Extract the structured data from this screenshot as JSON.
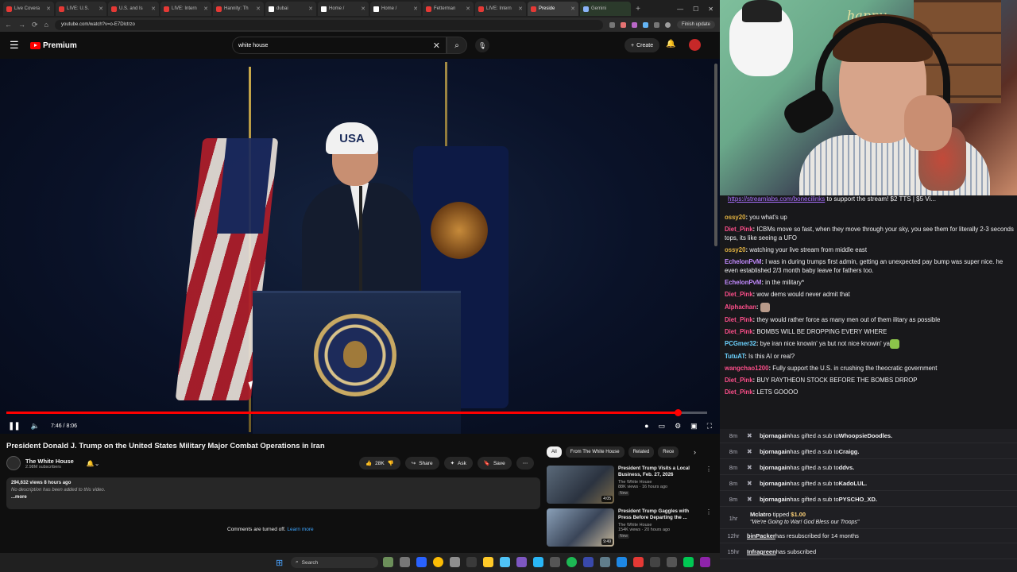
{
  "browser": {
    "tabs": [
      {
        "label": "Live Covera",
        "icon": "red"
      },
      {
        "label": "LIVE: U.S.",
        "icon": "red"
      },
      {
        "label": "U.S. and Is",
        "icon": "red"
      },
      {
        "label": "LIVE: Intern",
        "icon": "red"
      },
      {
        "label": "Hannity: Th",
        "icon": "red"
      },
      {
        "label": "dubai",
        "icon": "x"
      },
      {
        "label": "Home /",
        "icon": "x"
      },
      {
        "label": "Home /",
        "icon": "x"
      },
      {
        "label": "Fetterman",
        "icon": "red"
      },
      {
        "label": "LIVE: Intern",
        "icon": "red"
      },
      {
        "label": "Preside",
        "icon": "red"
      },
      {
        "label": "Gemini",
        "icon": "gem"
      }
    ],
    "url": "youtube.com/watch?v=o-E7Dlctrzo",
    "finish_update": "Finish update"
  },
  "youtube": {
    "brand": "Premium",
    "search_value": "white house",
    "create_label": "Create",
    "video": {
      "time": "7:46 / 8:06",
      "progress_fraction": 0.958,
      "cap_text": "USA"
    },
    "title": "President Donald J. Trump on the United States Military Major Combat Operations in Iran",
    "channel_name": "The White House",
    "subscribers": "2.98M subscribers",
    "actions": {
      "likes": "28K",
      "share": "Share",
      "ask": "Ask",
      "save": "Save"
    },
    "description": {
      "views": "294,632 views  8 hours ago",
      "text": "No description has been added to this video.",
      "more": "...more"
    },
    "comments_text": "Comments are turned off.",
    "comments_link": "Learn more",
    "chips": [
      "All",
      "From The White House",
      "Related",
      "Rece"
    ],
    "recommendations": [
      {
        "title": "President Trump Visits a Local Business, Feb. 27, 2026",
        "channel": "The White House",
        "meta": "88K views · 16 hours ago",
        "badge": "New",
        "duration": "4:05"
      },
      {
        "title": "President Trump Gaggles with Press Before Departing the ...",
        "channel": "The White House",
        "meta": "154K views · 20 hours ago",
        "badge": "New",
        "duration": "9:49"
      }
    ]
  },
  "taskbar": {
    "search_label": "Search"
  },
  "webcam": {
    "sign_text": "happy"
  },
  "chat": {
    "top_link": "https://streamlabs.com/bonecilinks",
    "top_text": " to support the stream! $2 TTS | $5 Vi...",
    "messages": [
      {
        "user": "ossy20",
        "color": "#e3b341",
        "text": " you what's up"
      },
      {
        "user": "Diet_Pink",
        "color": "#ff4f8b",
        "text": " ICBMs move so fast, when they move through your sky, you see them for literally 2-3 seconds tops, its like seeing a UFO"
      },
      {
        "user": "ossy20",
        "color": "#e3b341",
        "text": " watching your live stream from middle east"
      },
      {
        "user": "EchelonPvM",
        "color": "#c38bff",
        "text": " I was in during trumps first admin, getting an unexpected pay bump was super nice. he even established 2/3 month baby leave for fathers too."
      },
      {
        "user": "EchelonPvM",
        "color": "#c38bff",
        "text": " in the military*"
      },
      {
        "user": "Diet_Pink",
        "color": "#ff4f8b",
        "text": " wow dems would never admit that"
      },
      {
        "user": "Alphachan",
        "color": "#ff4f8b",
        "text": " "
      },
      {
        "user": "Diet_Pink",
        "color": "#ff4f8b",
        "text": " they would rather force as many men out of them ilitary as possible"
      },
      {
        "user": "Diet_Pink",
        "color": "#ff4f8b",
        "text": " BOMBS WILL BE DROPPING EVERY WHERE"
      },
      {
        "user": "PCGmer32",
        "color": "#6cd3ff",
        "text": " bye iran  nice knowin' ya  but not nice knowin' ya"
      },
      {
        "user": "TutuAT",
        "color": "#6cd3ff",
        "text": " Is this AI or real?"
      },
      {
        "user": "wangchao1200",
        "color": "#ff4f8b",
        "text": " Fully support the U.S. in crushing the theocratic government"
      },
      {
        "user": "Diet_Pink",
        "color": "#ff4f8b",
        "text": " BUY RAYTHEON STOCK BEFORE THE BOMBS DRROP"
      },
      {
        "user": "Diet_Pink",
        "color": "#ff4f8b",
        "text": " LETS GOOOO"
      }
    ],
    "gifts": [
      {
        "ago": "8m",
        "from": "bjornagain",
        "mid": " has gifted a sub to ",
        "to": "WhoopsieDoodles."
      },
      {
        "ago": "8m",
        "from": "bjornagain",
        "mid": " has gifted a sub to ",
        "to": "Craigg."
      },
      {
        "ago": "8m",
        "from": "bjornagain",
        "mid": " has gifted a sub to ",
        "to": "ddvs."
      },
      {
        "ago": "8m",
        "from": "bjornagain",
        "mid": " has gifted a sub to ",
        "to": "KadoLUL."
      },
      {
        "ago": "8m",
        "from": "bjornagain",
        "mid": " has gifted a sub to ",
        "to": "PYSCHO_XD."
      }
    ],
    "tip": {
      "ago": "1hr",
      "user": "Mclatro",
      "text": " tipped ",
      "amount": "$1.00",
      "message": "\"We're Going to War! God Bless our Troops\""
    },
    "resub": {
      "ago": "12hr",
      "user": "binPacker",
      "text": " has resubscribed for 14 months"
    },
    "newsub": {
      "ago": "15hr",
      "user": "Infragreen",
      "text": " has subscribed"
    }
  }
}
